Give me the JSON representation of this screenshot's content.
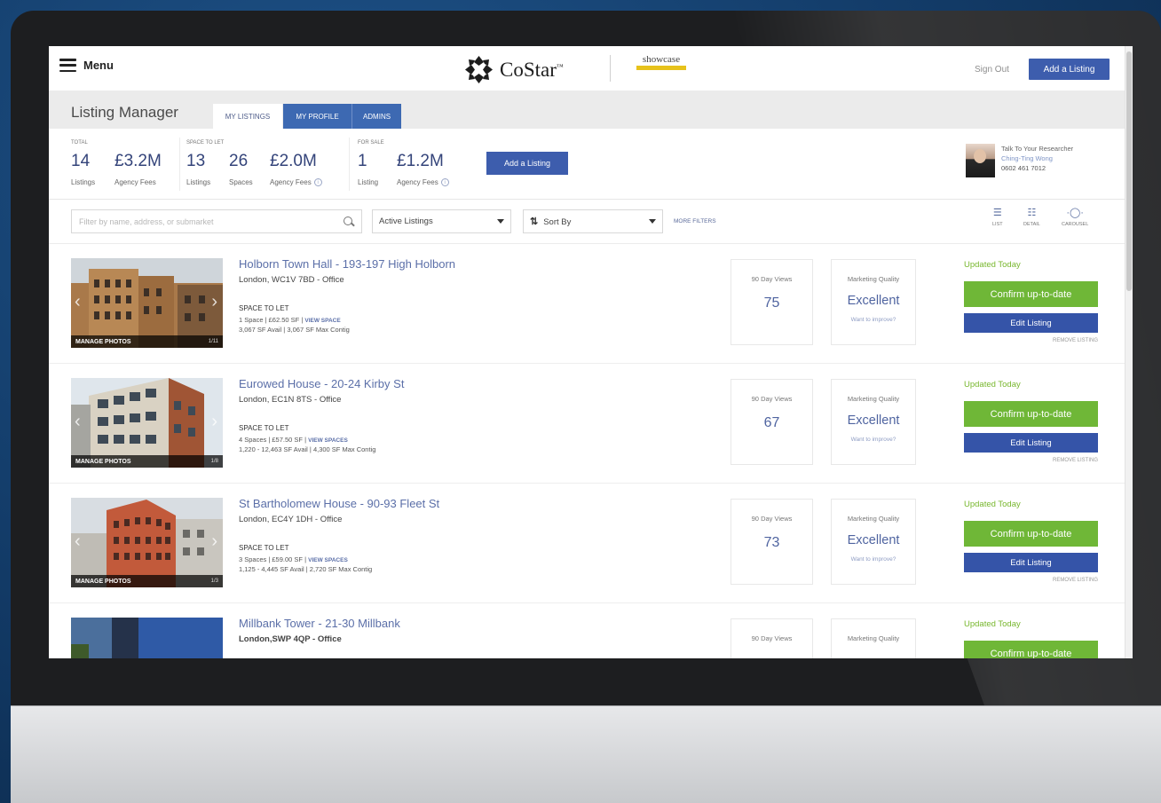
{
  "colors": {
    "brand_blue": "#3d5dad",
    "tab_blue": "#3d69b2",
    "confirm_green": "#6fb737",
    "edit_blue": "#3554a8",
    "updated_green": "#78b72e",
    "link_blue": "#5b6fa8"
  },
  "topbar": {
    "menu_label": "Menu",
    "menu_icon": "hamburger-icon",
    "logo_text": "CoStar",
    "logo_tm": "™",
    "showcase_text": "showcase",
    "sign_out": "Sign Out",
    "add_listing": "Add a Listing"
  },
  "header": {
    "title": "Listing Manager",
    "tabs": [
      {
        "label": "MY LISTINGS",
        "active": true
      },
      {
        "label": "MY PROFILE",
        "active": false
      },
      {
        "label": "ADMINS",
        "active": false
      }
    ]
  },
  "stats": {
    "total": {
      "label": "TOTAL",
      "listings_value": "14",
      "listings_caption": "Listings",
      "fees_value": "£3.2M",
      "fees_caption": "Agency Fees"
    },
    "space_to_let": {
      "label": "SPACE TO LET",
      "listings_value": "13",
      "listings_caption": "Listings",
      "spaces_value": "26",
      "spaces_caption": "Spaces",
      "fees_value": "£2.0M",
      "fees_caption": "Agency Fees"
    },
    "for_sale": {
      "label": "FOR SALE",
      "listings_value": "1",
      "listings_caption": "Listing",
      "fees_value": "£1.2M",
      "fees_caption": "Agency Fees"
    },
    "add_listing": "Add a Listing",
    "info_icon": "i",
    "researcher": {
      "title": "Talk To Your Researcher",
      "name": "Ching-Ting Wong",
      "phone": "0602 461 7012"
    }
  },
  "filters": {
    "search_placeholder": "Filter by name, address, or submarket",
    "status_select": "Active Listings",
    "sort_select": "Sort By",
    "sort_icon": "⇅",
    "more_filters": "MORE FILTERS",
    "view_options": [
      {
        "label": "LIST",
        "glyph": "☰",
        "active": true
      },
      {
        "label": "DETAIL",
        "glyph": "☷",
        "active": false
      },
      {
        "label": "CAROUSEL",
        "glyph": "·◯·",
        "active": false
      }
    ]
  },
  "listings": [
    {
      "title": "Holborn Town Hall - 193-197 High Holborn",
      "subtitle": "London, WC1V 7BD - Office",
      "space_heading": "SPACE TO LET",
      "spaces_line": "1 Space | £62.50 SF |",
      "view_label": "VIEW SPACE",
      "avail_line": "3,067 SF Avail | 3,067 SF Max Contig",
      "manage_photos": "MANAGE PHOTOS",
      "photo_count": "1/11",
      "views_label": "90 Day Views",
      "views": "75",
      "quality_label": "Marketing Quality",
      "quality": "Excellent",
      "improve": "Want to improve?",
      "updated": "Updated Today",
      "confirm": "Confirm up-to-date",
      "edit": "Edit Listing",
      "remove": "REMOVE LISTING"
    },
    {
      "title": "Eurowed House - 20-24 Kirby St",
      "subtitle": "London, EC1N 8TS - Office",
      "space_heading": "SPACE TO LET",
      "spaces_line": "4 Spaces | £57.50 SF |",
      "view_label": "VIEW SPACES",
      "avail_line": "1,220 - 12,463 SF Avail | 4,300 SF Max Contig",
      "manage_photos": "MANAGE PHOTOS",
      "photo_count": "1/8",
      "views_label": "90 Day Views",
      "views": "67",
      "quality_label": "Marketing Quality",
      "quality": "Excellent",
      "improve": "Want to improve?",
      "updated": "Updated Today",
      "confirm": "Confirm up-to-date",
      "edit": "Edit Listing",
      "remove": "REMOVE LISTING"
    },
    {
      "title": "St Bartholomew House - 90-93 Fleet St",
      "subtitle": "London, EC4Y 1DH - Office",
      "space_heading": "SPACE TO LET",
      "spaces_line": "3 Spaces | £59.00 SF |",
      "view_label": "VIEW SPACES",
      "avail_line": "1,125 - 4,445 SF Avail | 2,720 SF Max Contig",
      "manage_photos": "MANAGE PHOTOS",
      "photo_count": "1/3",
      "views_label": "90 Day Views",
      "views": "73",
      "quality_label": "Marketing Quality",
      "quality": "Excellent",
      "improve": "Want to improve?",
      "updated": "Updated Today",
      "confirm": "Confirm up-to-date",
      "edit": "Edit Listing",
      "remove": "REMOVE LISTING"
    },
    {
      "title": "Millbank Tower - 21-30 Millbank",
      "subtitle": "London,SWP 4QP - Office",
      "views_label": "90 Day Views",
      "quality_label": "Marketing Quality",
      "updated": "Updated Today",
      "confirm": "Confirm up-to-date"
    }
  ]
}
